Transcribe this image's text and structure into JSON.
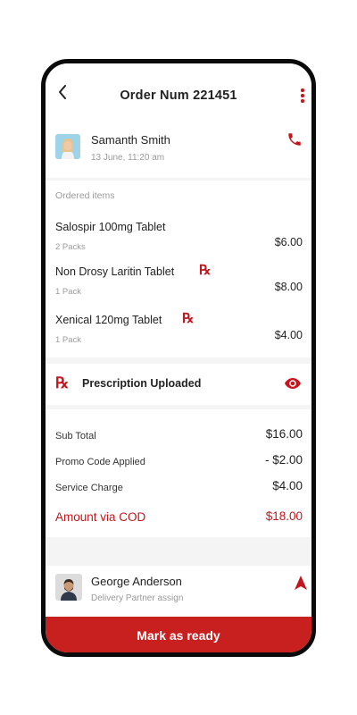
{
  "header": {
    "title": "Order Num 221451"
  },
  "customer": {
    "name": "Samanth Smith",
    "datetime": "13 June, 11:20 am"
  },
  "ordered_items": {
    "heading": "Ordered items",
    "rx_symbol": "℞",
    "items": [
      {
        "name": "Salospir 100mg Tablet",
        "qty": "2 Packs",
        "price": "$6.00",
        "requires_prescription": false
      },
      {
        "name": "Non Drosy Laritin Tablet",
        "qty": "1 Pack",
        "price": "$8.00",
        "requires_prescription": true
      },
      {
        "name": "Xenical 120mg Tablet",
        "qty": "1 Pack",
        "price": "$4.00",
        "requires_prescription": true
      }
    ]
  },
  "prescription": {
    "rx_symbol": "℞",
    "label": "Prescription Uploaded"
  },
  "summary": {
    "sub_total": {
      "label": "Sub Total",
      "value": "$16.00"
    },
    "promo": {
      "label": "Promo Code Applied",
      "value": "- $2.00"
    },
    "service": {
      "label": "Service Charge",
      "value": "$4.00"
    },
    "total": {
      "label": "Amount via COD",
      "value": "$18.00"
    }
  },
  "delivery": {
    "name": "George Anderson",
    "role": "Delivery Partner assign"
  },
  "action": {
    "label": "Mark as ready"
  },
  "colors": {
    "accent": "#c8201f",
    "rx": "#c4161c",
    "background": "#f4f4f4"
  },
  "icons": [
    "back-arrow-icon",
    "more-vertical-icon",
    "phone-icon",
    "rx-icon",
    "eye-icon",
    "navigation-arrow-icon"
  ]
}
